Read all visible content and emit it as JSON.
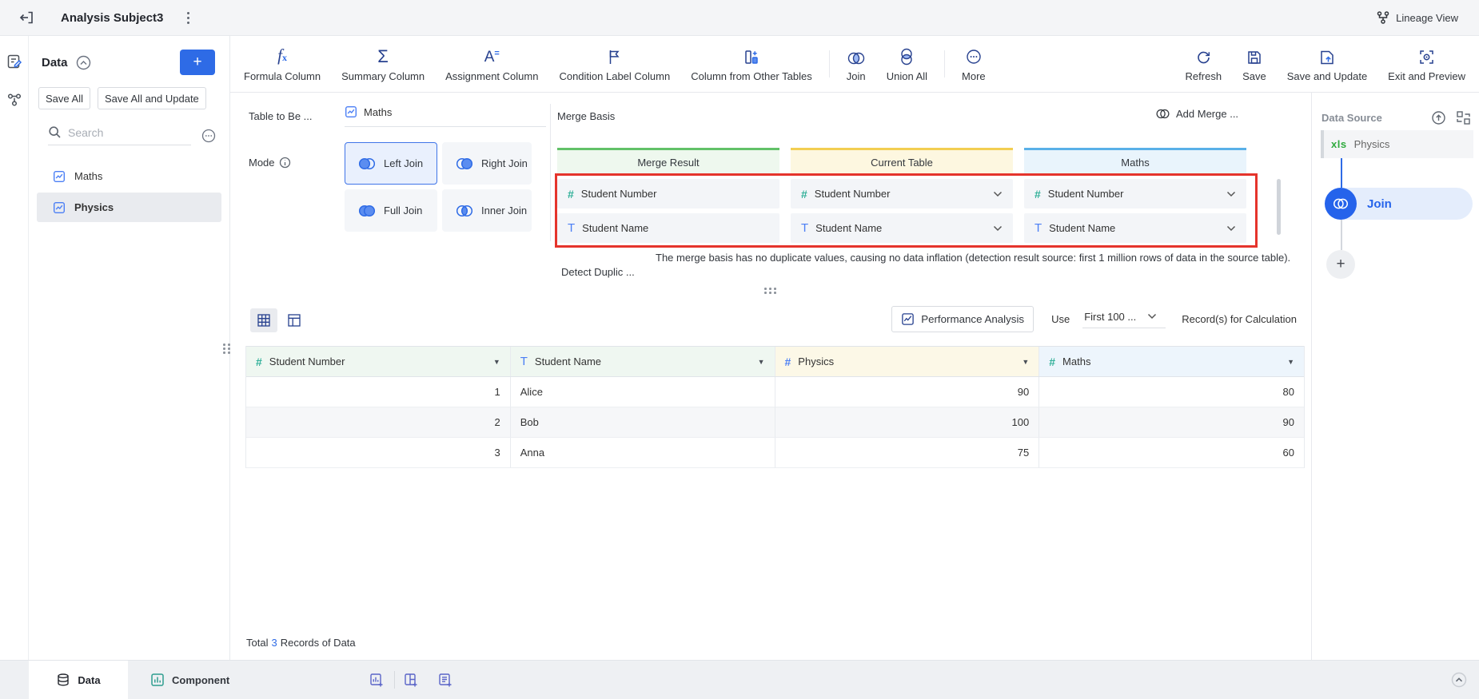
{
  "colors": {
    "primary_blue": "#2e6be6",
    "navy_icon": "#27418f",
    "highlight_red": "#e5342c",
    "numeric_field_teal": "#31b099",
    "text_field_blue": "#4b7ff5",
    "merge_result_green": "#62c168",
    "current_table_yellow": "#f2ce52",
    "maths_blue": "#59b0e8",
    "xls_green": "#2faa3e",
    "component_add_purple": "#5a64c8"
  },
  "icons": [
    "exit-back",
    "kebab-menu",
    "lineage",
    "edit-note",
    "data-flow",
    "collapse-all",
    "plus",
    "search",
    "ellipsis-circle",
    "table-file",
    "formula-fx",
    "sigma",
    "assignment",
    "condition-flag",
    "column-add",
    "join-venn",
    "union-all",
    "more-ellipsis",
    "refresh",
    "save",
    "save-update",
    "exit-preview",
    "info",
    "chevron-down",
    "hash",
    "text-T",
    "grid-view",
    "form-view",
    "performance",
    "filter-triangle",
    "database",
    "component-chart",
    "chart-add",
    "layout-add",
    "list-add",
    "update-circle",
    "swap-layout",
    "chevron-up",
    "drag-dots"
  ],
  "topbar": {
    "title": "Analysis Subject3",
    "lineage_label": "Lineage View"
  },
  "sidebar": {
    "title": "Data",
    "add_label": "+",
    "save_all": "Save All",
    "save_all_update": "Save All and Update",
    "search_placeholder": "Search",
    "items": [
      {
        "label": "Maths",
        "selected": false
      },
      {
        "label": "Physics",
        "selected": true
      }
    ]
  },
  "toolbar": {
    "formula": "Formula Column",
    "summary": "Summary Column",
    "assignment": "Assignment Column",
    "condition": "Condition Label Column",
    "other_tables": "Column from Other Tables",
    "join": "Join",
    "union_all": "Union All",
    "more": "More",
    "refresh": "Refresh",
    "save": "Save",
    "save_update": "Save and Update",
    "exit_preview": "Exit and Preview"
  },
  "join": {
    "table_label": "Table to Be ...",
    "table_value": "Maths",
    "mode_label": "Mode",
    "modes": {
      "left": "Left Join",
      "right": "Right Join",
      "full": "Full Join",
      "inner": "Inner Join"
    },
    "selected_mode": "Left Join",
    "merge_basis": "Merge Basis",
    "add_merge": "Add Merge ...",
    "grid": [
      {
        "title": "Merge Result",
        "rows": [
          "Student Number",
          "Student Name"
        ]
      },
      {
        "title": "Current Table",
        "rows": [
          "Student Number",
          "Student Name"
        ]
      },
      {
        "title": "Maths",
        "rows": [
          "Student Number",
          "Student Name"
        ]
      }
    ],
    "detect_label": "Detect Duplic ...",
    "detect_message": "The merge basis has no duplicate values, causing no data inflation (detection result source: first 1 million rows of data in the source table)."
  },
  "table": {
    "performance": "Performance Analysis",
    "use_label": "Use",
    "records_value": "First 100 ...",
    "records_label": "Record(s) for Calculation",
    "headers": [
      "Student Number",
      "Student Name",
      "Physics",
      "Maths"
    ],
    "rows": [
      [
        "1",
        "Alice",
        "90",
        "80"
      ],
      [
        "2",
        "Bob",
        "100",
        "90"
      ],
      [
        "3",
        "Anna",
        "75",
        "60"
      ]
    ],
    "total_prefix": "Total",
    "total_count": "3",
    "total_suffix": "Records of Data"
  },
  "datasource": {
    "title": "Data Source",
    "xls_label": "xls",
    "table_name": "Physics",
    "join_label": "Join",
    "add_label": "+"
  },
  "bottom": {
    "data_tab": "Data",
    "component_tab": "Component"
  }
}
